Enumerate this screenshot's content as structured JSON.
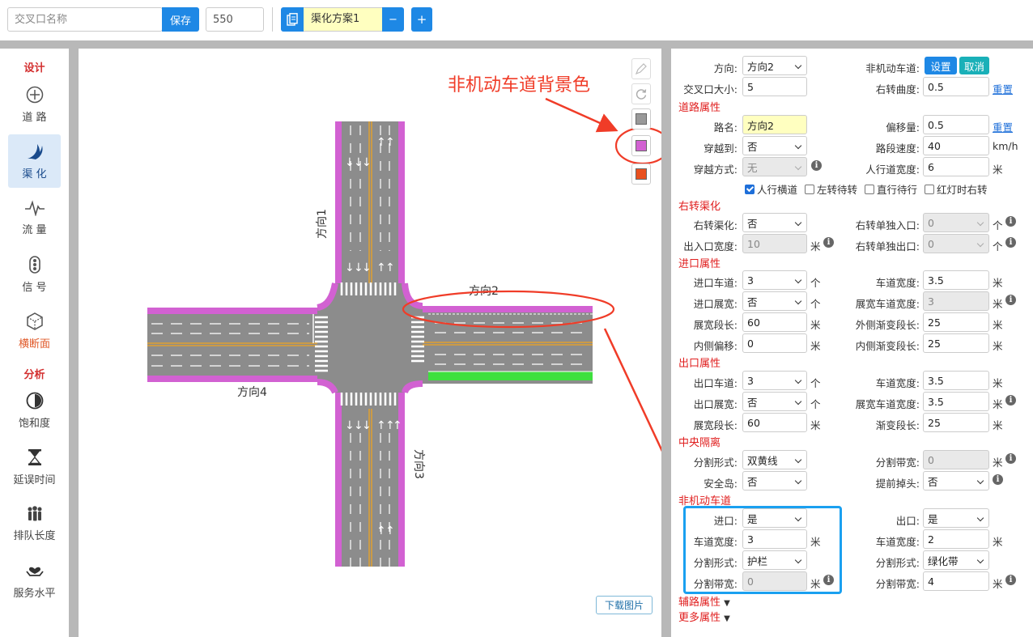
{
  "topbar": {
    "name_placeholder": "交叉口名称",
    "save_label": "保存",
    "size_value": "550",
    "scheme_name": "渠化方案1",
    "minus_label": "−",
    "plus_label": "+"
  },
  "sidebar": {
    "section_design": "设计",
    "section_analysis": "分析",
    "items": [
      {
        "label": "道 路",
        "icon": "crosshair-icon"
      },
      {
        "label": "渠 化",
        "icon": "channel-icon"
      },
      {
        "label": "流 量",
        "icon": "pulse-icon"
      },
      {
        "label": "信 号",
        "icon": "traffic-light-icon"
      },
      {
        "label": "横断面",
        "icon": "cube-icon"
      },
      {
        "label": "饱和度",
        "icon": "half-circle-icon"
      },
      {
        "label": "延误时间",
        "icon": "hourglass-icon"
      },
      {
        "label": "排队长度",
        "icon": "people-icon"
      },
      {
        "label": "服务水平",
        "icon": "hand-heart-icon"
      }
    ]
  },
  "canvas": {
    "annotation": "非机动车道背景色",
    "dir1": "方向1",
    "dir2": "方向2",
    "dir3": "方向3",
    "dir4": "方向4",
    "download_label": "下载图片",
    "colors": {
      "road": "#8c8c8c",
      "bike_lane": "#d261d2",
      "green_belt": "#3ee03e",
      "yellow_line": "#e0a030",
      "swatch_gray": "#999999",
      "swatch_purple": "#d261d2",
      "swatch_orange": "#e8501e",
      "annotation_red": "#f03c28",
      "highlight_blue": "#1aa0f0"
    }
  },
  "panel": {
    "direction_label": "方向:",
    "direction_value": "方向2",
    "bike_lane_label": "非机动车道:",
    "set_label": "设置",
    "cancel_label": "取消",
    "size_label": "交叉口大小:",
    "size_value": "5",
    "right_curve_label": "右转曲度:",
    "right_curve_value": "0.5",
    "reset_label": "重置",
    "road_section": "道路属性",
    "road_name_label": "路名:",
    "road_name_value": "方向2",
    "offset_label": "偏移量:",
    "offset_value": "0.5",
    "cross_to_label": "穿越到:",
    "cross_to_value": "否",
    "speed_label": "路段速度:",
    "speed_value": "40",
    "speed_unit": "km/h",
    "cross_mode_label": "穿越方式:",
    "cross_mode_value": "无",
    "sidewalk_width_label": "人行道宽度:",
    "sidewalk_width_value": "6",
    "unit_m": "米",
    "unit_count": "个",
    "cb_crosswalk": "人行横道",
    "cb_left_wait": "左转待转",
    "cb_straight_wait": "直行待行",
    "cb_red_right": "红灯时右转",
    "right_section": "右转渠化",
    "right_channel_label": "右转渠化:",
    "right_channel_value": "否",
    "right_entry_label": "右转单独入口:",
    "right_entry_value": "0",
    "io_width_label": "出入口宽度:",
    "io_width_value": "10",
    "right_exit_label": "右转单独出口:",
    "right_exit_value": "0",
    "entry_section": "进口属性",
    "entry_lanes_label": "进口车道:",
    "entry_lanes_value": "3",
    "lane_width_label": "车道宽度:",
    "entry_lane_width_value": "3.5",
    "entry_widen_label": "进口展宽:",
    "entry_widen_value": "否",
    "widen_lane_width_label": "展宽车道宽度:",
    "entry_widen_lane_width_value": "3",
    "widen_len_label": "展宽段长:",
    "entry_widen_len_value": "60",
    "outer_taper_label": "外侧渐变段长:",
    "outer_taper_value": "25",
    "inner_offset_label": "内侧偏移:",
    "inner_offset_value": "0",
    "inner_taper_label": "内侧渐变段长:",
    "inner_taper_value": "25",
    "exit_section": "出口属性",
    "exit_lanes_label": "出口车道:",
    "exit_lanes_value": "3",
    "exit_lane_width_value": "3.5",
    "exit_widen_label": "出口展宽:",
    "exit_widen_value": "否",
    "exit_widen_lane_width_value": "3.5",
    "exit_widen_len_value": "60",
    "taper_label": "渐变段长:",
    "exit_taper_value": "25",
    "median_section": "中央隔离",
    "divider_form_label": "分割形式:",
    "median_form_value": "双黄线",
    "divider_width_label": "分割带宽:",
    "median_width_value": "0",
    "island_label": "安全岛:",
    "island_value": "否",
    "early_uturn_label": "提前掉头:",
    "early_uturn_value": "否",
    "bike_section": "非机动车道",
    "bike_entry_label": "进口:",
    "bike_entry_value": "是",
    "bike_exit_label": "出口:",
    "bike_exit_value": "是",
    "bike_entry_width_value": "3",
    "bike_exit_width_value": "2",
    "bike_entry_form_value": "护栏",
    "bike_exit_form_value": "绿化带",
    "bike_entry_div_width_value": "0",
    "bike_exit_div_width_value": "4",
    "aux_section": "辅路属性",
    "more_section": "更多属性"
  }
}
